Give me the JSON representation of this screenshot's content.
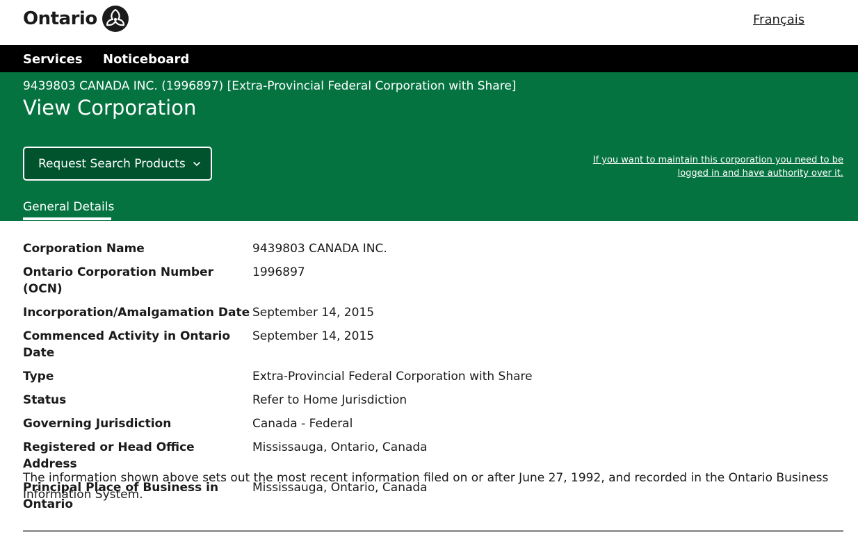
{
  "header": {
    "logo_text": "Ontario",
    "lang_link": "Français"
  },
  "nav": {
    "items": [
      {
        "label": "Services"
      },
      {
        "label": "Noticeboard"
      }
    ]
  },
  "banner": {
    "crumb": "9439803 CANADA INC. (1996897) [Extra-Provincial Federal Corporation with Share]",
    "title": "View Corporation",
    "request_button": "Request Search Products",
    "maintain_note": "If you want to maintain this corporation you need to be logged in and have authority over it.",
    "tab": "General Details"
  },
  "details": {
    "rows": [
      {
        "label": "Corporation Name",
        "value": "9439803 CANADA INC."
      },
      {
        "label": "Ontario Corporation Number (OCN)",
        "value": "1996897"
      },
      {
        "label": "Incorporation/Amalgamation Date",
        "value": "September 14, 2015"
      },
      {
        "label": "Commenced Activity in Ontario Date",
        "value": "September 14, 2015"
      },
      {
        "label": "Type",
        "value": "Extra-Provincial Federal Corporation with Share"
      },
      {
        "label": "Status",
        "value": "Refer to Home Jurisdiction"
      },
      {
        "label": "Governing Jurisdiction",
        "value": "Canada - Federal"
      },
      {
        "label": "Registered or Head Office Address",
        "value": "Mississauga, Ontario, Canada"
      },
      {
        "label": "Principal Place of Business in Ontario",
        "value": "Mississauga, Ontario, Canada"
      }
    ],
    "footnote": "The information shown above sets out the most recent information filed on or after June 27, 1992, and recorded in the Ontario Business Information System."
  },
  "colors": {
    "banner_green": "#047340",
    "nav_black": "#000000"
  }
}
